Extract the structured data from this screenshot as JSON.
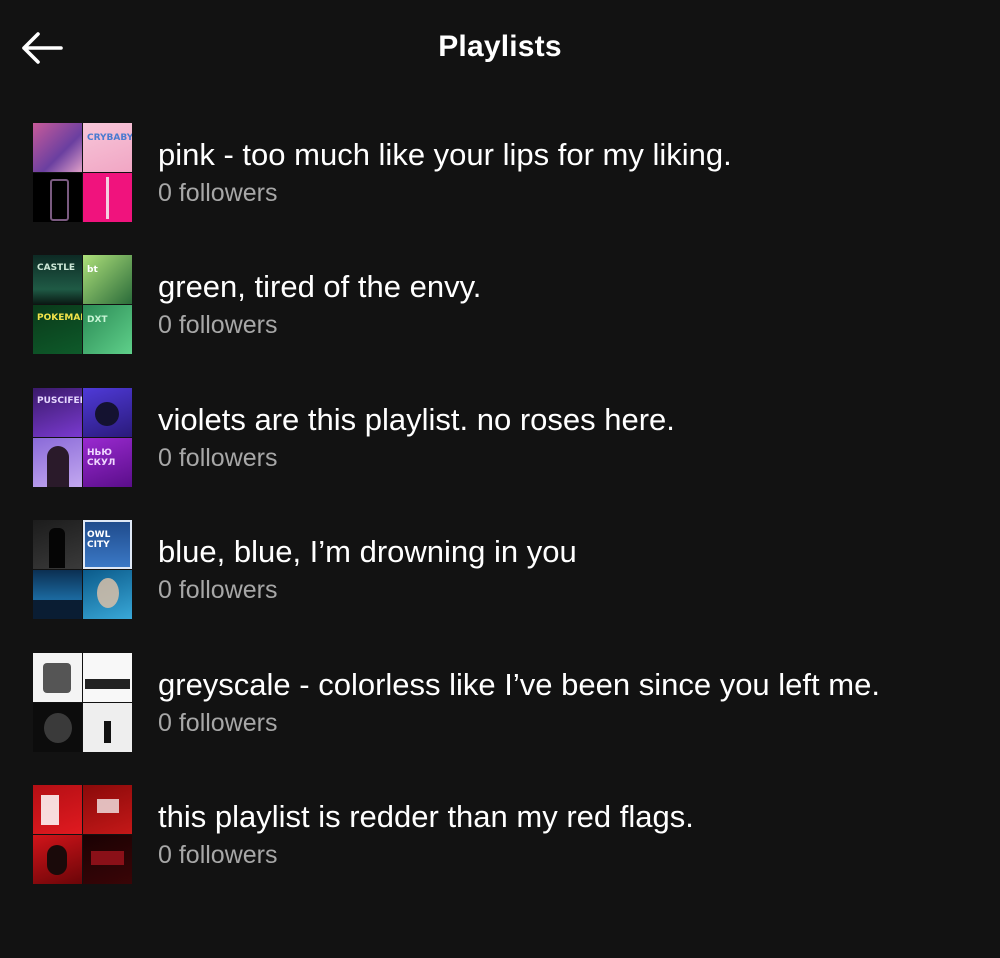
{
  "header": {
    "title": "Playlists",
    "back_icon": "arrow-left-icon"
  },
  "playlists": [
    {
      "name": "pink - too much like your lips for my liking.",
      "followers": "0 followers",
      "covers": [
        {
          "bg": "linear-gradient(135deg,#c85b9a,#6a3fa0 60%,#e0a0c8)",
          "label": ""
        },
        {
          "bg": "linear-gradient(160deg,#f7c6d9,#f1a6c4)",
          "label": "CRYBABY",
          "label_color": "#4a7bd0"
        },
        {
          "bg": "#000000",
          "label": "",
          "accent": "coffin"
        },
        {
          "bg": "#f0137d",
          "label": "",
          "accent": "dagger"
        }
      ]
    },
    {
      "name": "green, tired of the envy.",
      "followers": "0 followers",
      "covers": [
        {
          "bg": "linear-gradient(180deg,#0d2a24,#1f5a45 70%,#0a1a14)",
          "label": "CASTLE",
          "label_color": "#cfe8d8"
        },
        {
          "bg": "linear-gradient(135deg,#aee07a,#2a6b3a)",
          "label": "bt",
          "label_color": "#ffffff"
        },
        {
          "bg": "linear-gradient(160deg,#0a3a1a,#0e5a2a)",
          "label": "POKEMAN",
          "label_color": "#f2e34a"
        },
        {
          "bg": "linear-gradient(135deg,#2b8a55,#5fd08a)",
          "label": "DXT",
          "label_color": "#c8f5d6"
        }
      ]
    },
    {
      "name": "violets are this playlist. no roses here.",
      "followers": "0 followers",
      "covers": [
        {
          "bg": "linear-gradient(160deg,#3a1a6a,#7a3ad0)",
          "label": "PUSCIFER",
          "label_color": "#e6d8ff"
        },
        {
          "bg": "linear-gradient(160deg,#4f3ad8,#2a1a7a)",
          "label": "",
          "accent": "creature"
        },
        {
          "bg": "linear-gradient(160deg,#8a6ad8,#c3a8f0)",
          "label": "",
          "accent": "portrait"
        },
        {
          "bg": "linear-gradient(160deg,#9a2ad0,#5a0e8a)",
          "label": "НЬЮ СКУЛ",
          "label_color": "#f0d8ff"
        }
      ]
    },
    {
      "name": "blue, blue, I’m drowning in you",
      "followers": "0 followers",
      "covers": [
        {
          "bg": "linear-gradient(160deg,#1c1c1c,#3a3a3a)",
          "label": "",
          "accent": "figure"
        },
        {
          "bg": "linear-gradient(180deg,#1e4a8a,#3c7ac8)",
          "label": "OWL CITY",
          "label_color": "#ffffff",
          "border": "#dfe8f5"
        },
        {
          "bg": "linear-gradient(180deg,#0b2f52,#1b6aa0 60%,#0b2f52)",
          "label": "",
          "accent": "stage"
        },
        {
          "bg": "linear-gradient(160deg,#0b5a8a,#39a8d8)",
          "label": "",
          "accent": "face"
        }
      ]
    },
    {
      "name": "greyscale - colorless like I’ve been since you left me.",
      "followers": "0 followers",
      "covers": [
        {
          "bg": "#f4f4f4",
          "label": "",
          "accent": "sketch"
        },
        {
          "bg": "#f8f8f8",
          "label": "",
          "accent": "crowd"
        },
        {
          "bg": "#0c0c0c",
          "label": "",
          "accent": "mask"
        },
        {
          "bg": "#eeeeee",
          "label": "",
          "accent": "small-figure"
        }
      ]
    },
    {
      "name": "this playlist is redder than my red flags.",
      "followers": "0 followers",
      "covers": [
        {
          "bg": "linear-gradient(160deg,#b40f14,#e01a20)",
          "label": "",
          "accent": "poster"
        },
        {
          "bg": "linear-gradient(160deg,#8a0a0a,#c41818)",
          "label": "",
          "accent": "text-block"
        },
        {
          "bg": "linear-gradient(160deg,#d2141a,#6a0508)",
          "label": "",
          "accent": "girl"
        },
        {
          "bg": "linear-gradient(160deg,#1a0203,#3a0507)",
          "label": "",
          "accent": "logo"
        }
      ]
    }
  ]
}
